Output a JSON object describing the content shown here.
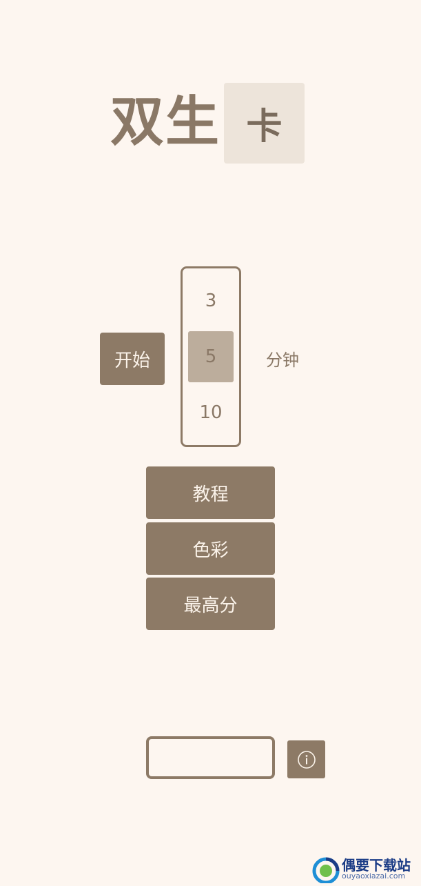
{
  "colors": {
    "background": "#fdf6f0",
    "primary": "#8d7a66",
    "title": "#8a7866",
    "card": "#ede4da",
    "selected": "#bcad9c",
    "button_text": "#fbf3ea"
  },
  "title": {
    "text": "双生",
    "card_char": "卡"
  },
  "controls": {
    "start_label": "开始",
    "duration_options": [
      "3",
      "5",
      "10"
    ],
    "selected_duration": "5",
    "unit_label": "分钟"
  },
  "menu": {
    "tutorial_label": "教程",
    "colors_label": "色彩",
    "highscore_label": "最高分"
  },
  "bottom": {
    "info_icon": "info-icon"
  },
  "watermark": {
    "name": "偶要下载站",
    "domain": "ouyaoxiazai.com"
  }
}
